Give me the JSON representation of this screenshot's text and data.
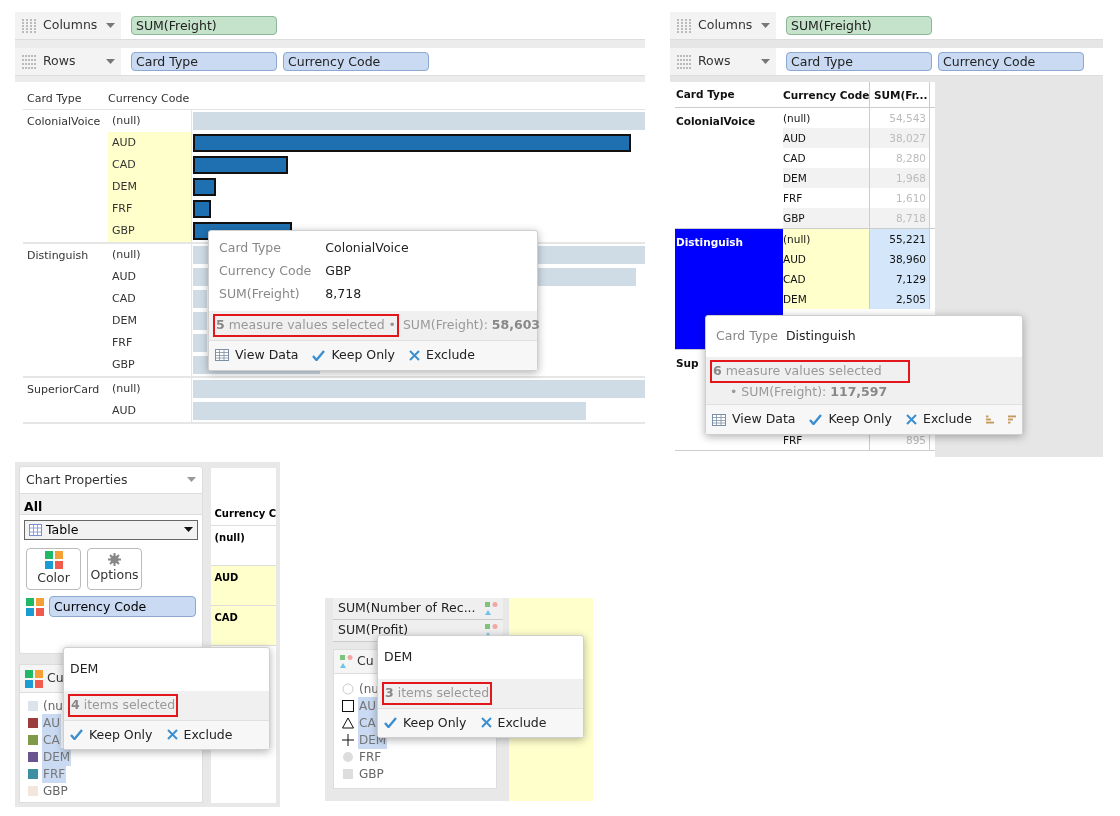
{
  "bar_view": {
    "shelves": [
      {
        "kind": "columns",
        "label": "Columns",
        "pills": [
          {
            "label": "SUM(Freight)",
            "kind": "measure"
          }
        ]
      },
      {
        "kind": "rows",
        "label": "Rows",
        "pills": [
          {
            "label": "Card Type",
            "kind": "dimension"
          },
          {
            "label": "Currency Code",
            "kind": "dimension"
          }
        ]
      }
    ],
    "headers": [
      "Card Type",
      "Currency Code"
    ],
    "groups": [
      {
        "card_type": "ColonialVoice",
        "rows": [
          {
            "code": "(null)",
            "selected": false,
            "level": 1
          },
          {
            "code": "AUD",
            "selected": true,
            "level": 0.97
          },
          {
            "code": "CAD",
            "selected": true,
            "level": 0.21
          },
          {
            "code": "DEM",
            "selected": true,
            "level": 0.05
          },
          {
            "code": "FRF",
            "selected": true,
            "level": 0.04
          },
          {
            "code": "GBP",
            "selected": true,
            "level": 0.22
          }
        ]
      },
      {
        "card_type": "Distinguish",
        "rows": [
          {
            "code": "(null)",
            "selected": false,
            "level": 1
          },
          {
            "code": "AUD",
            "selected": false,
            "level": 0.98
          },
          {
            "code": "CAD",
            "selected": false
          },
          {
            "code": "DEM",
            "selected": false
          },
          {
            "code": "FRF",
            "selected": false
          },
          {
            "code": "GBP",
            "selected": false,
            "level": 0.28
          }
        ]
      },
      {
        "card_type": "SuperiorCard",
        "rows": [
          {
            "code": "(null)",
            "selected": false,
            "level": 1
          },
          {
            "code": "AUD",
            "selected": false,
            "level": 0.87
          }
        ]
      }
    ],
    "tooltip": {
      "fields": [
        {
          "label": "Card Type",
          "value": "ColonialVoice"
        },
        {
          "label": "Currency Code",
          "value": "GBP"
        },
        {
          "label": "SUM(Freight)",
          "value": "8,718"
        }
      ],
      "summary": {
        "count": "5",
        "text": "measure values selected",
        "bullet": "•",
        "detail_label": "SUM(Freight):",
        "detail_value": "58,603",
        "kind": "inline"
      },
      "actions": [
        {
          "kind": "view_data",
          "label": "View Data"
        },
        {
          "kind": "keep_only",
          "label": "Keep Only"
        },
        {
          "kind": "exclude",
          "label": "Exclude"
        }
      ]
    }
  },
  "table_view": {
    "shelves": [
      {
        "kind": "columns",
        "label": "Columns",
        "pills": [
          {
            "label": "SUM(Freight)",
            "kind": "measure"
          }
        ]
      },
      {
        "kind": "rows",
        "label": "Rows",
        "pills": [
          {
            "label": "Card Type",
            "kind": "dimension"
          },
          {
            "label": "Currency Code",
            "kind": "dimension"
          }
        ]
      }
    ],
    "headers": [
      "Card Type",
      "Currency Code",
      "SUM(Fr..."
    ],
    "groups": [
      {
        "card_type": "ColonialVoice",
        "selected": false,
        "rows": [
          {
            "code": "(null)",
            "value": "54,543"
          },
          {
            "code": "AUD",
            "value": "38,027"
          },
          {
            "code": "CAD",
            "value": "8,280"
          },
          {
            "code": "DEM",
            "value": "1,968"
          },
          {
            "code": "FRF",
            "value": "1,610"
          },
          {
            "code": "GBP",
            "value": "8,718"
          }
        ]
      },
      {
        "card_type": "Distinguish",
        "selected": true,
        "rows": [
          {
            "code": "(null)",
            "value": "55,221"
          },
          {
            "code": "AUD",
            "value": "38,960"
          },
          {
            "code": "CAD",
            "value": "7,129"
          },
          {
            "code": "DEM",
            "value": "2,505"
          }
        ]
      },
      {
        "card_type": "Sup",
        "selected": false,
        "rows": [
          {
            "code": "FRF",
            "value": "895"
          }
        ]
      }
    ],
    "tooltip": {
      "title": "Distinguish",
      "title_label": "Card Type",
      "summary": {
        "count": "6",
        "text": "measure values selected",
        "bullet": "•",
        "detail_label": "SUM(Freight):",
        "detail_value": "117,597",
        "kind": "stacked"
      },
      "actions": [
        {
          "kind": "view_data",
          "label": "View Data"
        },
        {
          "kind": "keep_only",
          "label": "Keep Only"
        },
        {
          "kind": "exclude",
          "label": "Exclude"
        },
        {
          "kind": "sort_ascending"
        },
        {
          "kind": "sort_descending"
        }
      ]
    }
  },
  "color_legend_view": {
    "properties": {
      "title": "Chart Properties",
      "section": "All",
      "chart_type": "Table",
      "buttons": [
        {
          "kind": "color",
          "label": "Color"
        },
        {
          "kind": "options",
          "label": "Options"
        }
      ],
      "color_field": "Currency Code"
    },
    "partial_table": {
      "header": "Currency C",
      "rows": [
        {
          "code": "(null)",
          "selected": false
        },
        {
          "code": "AUD",
          "selected": true
        },
        {
          "code": "CAD",
          "selected": true
        }
      ]
    },
    "legend": {
      "title": "Cu",
      "items": [
        {
          "label": "(nu",
          "color": "#dde3ea",
          "selected": false
        },
        {
          "label": "AU",
          "color": "#9c3d3d",
          "selected": true
        },
        {
          "label": "CA",
          "color": "#7f9a48",
          "selected": true
        },
        {
          "label": "DEM",
          "color": "#6a5490",
          "selected": true
        },
        {
          "label": "FRF",
          "color": "#3e8fa1",
          "selected": true
        },
        {
          "label": "GBP",
          "color": "#f3e6dd",
          "selected": false
        }
      ]
    },
    "tooltip": {
      "title": "DEM",
      "summary": {
        "count": "4",
        "text": "items selected"
      },
      "actions": [
        {
          "kind": "keep_only",
          "label": "Keep Only"
        },
        {
          "kind": "exclude",
          "label": "Exclude"
        }
      ]
    }
  },
  "shape_legend_view": {
    "pills": [
      "SUM(Number of Rec...",
      "SUM(Profit)"
    ],
    "legend": {
      "title": "Cu",
      "items": [
        {
          "label": "(nu",
          "kind": "circle_outline",
          "selected": false
        },
        {
          "label": "AU",
          "kind": "square_outline",
          "selected": true
        },
        {
          "label": "CA",
          "kind": "triangle_outline",
          "selected": true
        },
        {
          "label": "DEM",
          "kind": "plus",
          "selected": true
        },
        {
          "label": "FRF",
          "kind": "circle_filled",
          "selected": false
        },
        {
          "label": "GBP",
          "kind": "square_filled",
          "selected": false
        }
      ]
    },
    "tooltip": {
      "title": "DEM",
      "summary": {
        "count": "3",
        "text": "items selected"
      },
      "actions": [
        {
          "kind": "keep_only",
          "label": "Keep Only"
        },
        {
          "kind": "exclude",
          "label": "Exclude"
        }
      ]
    }
  }
}
